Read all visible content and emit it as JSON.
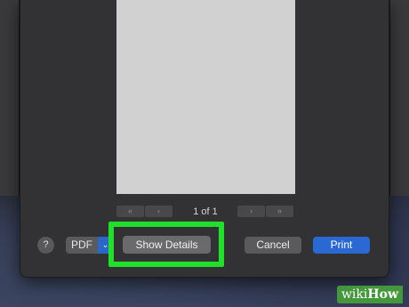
{
  "preview": {
    "page_indicator": "1 of 1",
    "first_label": "«",
    "prev_label": "‹",
    "next_label": "›",
    "last_label": "»"
  },
  "footer": {
    "help_label": "?",
    "pdf_label": "PDF",
    "pdf_arrow": "⌄",
    "show_details_label": "Show Details",
    "cancel_label": "Cancel",
    "print_label": "Print"
  },
  "colors": {
    "highlight": "#21e02b",
    "primary_button": "#2a68d4"
  },
  "watermark": {
    "prefix": "wiki",
    "suffix": "How"
  }
}
